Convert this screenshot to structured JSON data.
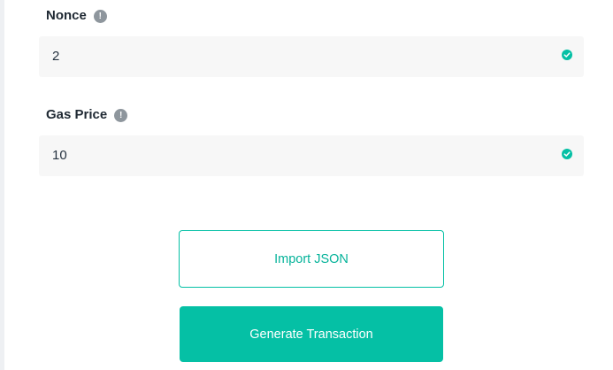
{
  "nonce": {
    "label": "Nonce",
    "info_icon": "!",
    "value": "2",
    "valid_icon": "check-circle-icon"
  },
  "gas_price": {
    "label": "Gas Price",
    "info_icon": "!",
    "value": "10",
    "valid_icon": "check-circle-icon"
  },
  "actions": {
    "import_label": "Import JSON",
    "generate_label": "Generate Transaction"
  },
  "colors": {
    "accent": "#05c0a5",
    "input_bg": "#f7f7f7",
    "info_icon": "#8e969d"
  }
}
